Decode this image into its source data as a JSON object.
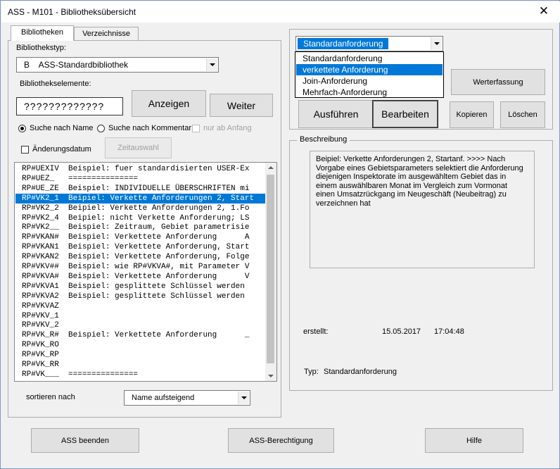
{
  "window": {
    "title": "ASS - M101 - Bibliotheksübersicht",
    "close_glyph": "✕"
  },
  "tabs": [
    {
      "label": "Bibliotheken"
    },
    {
      "label": "Verzeichnisse"
    }
  ],
  "left": {
    "lib_type_label": "Bibliothekstyp:",
    "lib_type_value": "B    ASS-Standardbibliothek",
    "elements_label": "Bibliothekselemente:",
    "search_value": "?????????????",
    "show_button": "Anzeigen",
    "next_button": "Weiter",
    "radio_name": "Suche nach Name",
    "radio_comment": "Suche nach Kommentar",
    "only_start": "nur ab Anfang",
    "change_date": "Änderungsdatum",
    "time_select": "Zeitauswahl",
    "sort_label": "sortieren nach",
    "sort_value": "Name aufsteigend"
  },
  "list_rows": [
    "RP#UEXIV  Beispiel: fuer standardisierten USER-Ex",
    "RP#UEZ_   ===============",
    "RP#UE_ZE  Beispiel: INDIVIDUELLE ÜBERSCHRIFTEN mi",
    "RP#VK2_1  Beipiel: Verkette Anforderungen 2, Start",
    "RP#VK2_2  Beipiel: Verkette Anforderungen 2, 1.Fo",
    "RP#VK2_4  Beipiel: nicht Verkette Anforderung; LS",
    "RP#VK2__  Beispiel: Zeitraum, Gebiet parametrisie",
    "RP#VKAN#  Beispiel: Verkettete Anforderung      A",
    "RP#VKAN1  Beispiel: Verkettete Anforderung, Start",
    "RP#VKAN2  Beispiel: Verkettete Anforderung, Folge",
    "RP#VKV##  Beispiel: wie RP#VKVA#, mit Parameter V",
    "RP#VKVA#  Beispiel: Verkettete Anforderung      V",
    "RP#VKVA1  Beispiel: gesplittete Schlüssel werden",
    "RP#VKVA2  Beispiel: gesplittete Schlüssel werden",
    "RP#VKVAZ",
    "RP#VKV_1",
    "RP#VKV_2",
    "RP#VK_R#  Beispiel: Verkettete Anforderung      _",
    "RP#VK_RO",
    "RP#VK_RP",
    "RP#VK_RR",
    "RP#VK___  ==============="
  ],
  "right": {
    "type_combo_value": "Standardanforderung",
    "dropdown_options": [
      "Standardanforderung",
      "verkettete Anforderung",
      "Join-Anforderung",
      "Mehrfach-Anforderung"
    ],
    "value_entry_button": "Werterfassung",
    "execute_button": "Ausführen",
    "edit_button": "Bearbeiten",
    "copy_button": "Kopieren",
    "delete_button": "Löschen",
    "description_label": "Beschreibung",
    "description_text": "Beipiel: Verkette Anforderungen 2, Startanf.    >>>>     Nach Vorgabe eines Gebietsparameters selektiert die Anforderung diejenigen Inspektorate im ausgewähltem Gebiet das in einem auswählbaren Monat im Vergleich zum Vormonat einen Umsatzrückgang im Neugeschäft (Neubeitrag) zu verzeichnen hat",
    "created_label": "erstellt:",
    "created_date": "15.05.2017",
    "created_time": "17:04:48",
    "type_label": "Typ:",
    "type_value": "Standardanforderung"
  },
  "bottom": {
    "exit_button": "ASS beenden",
    "permission_button": "ASS-Berechtigung",
    "help_button": "Hilfe"
  },
  "colors": {
    "selection": "#0078d7",
    "background": "#f0f0f0"
  }
}
